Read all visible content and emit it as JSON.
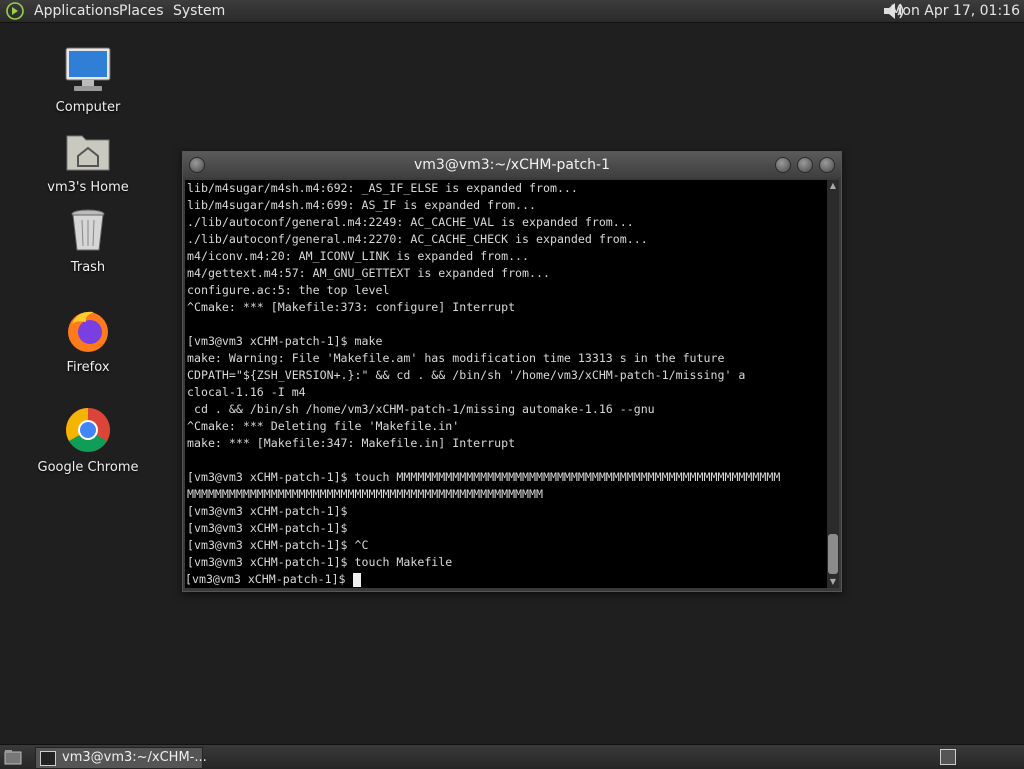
{
  "top_panel": {
    "menus": [
      "Applications",
      "Places",
      "System"
    ],
    "clock": "Mon Apr 17, 01:16"
  },
  "desktop": {
    "icons": [
      {
        "label": "Computer",
        "icon": "computer-icon"
      },
      {
        "label": "vm3's Home",
        "icon": "home-folder-icon"
      },
      {
        "label": "Trash",
        "icon": "trash-icon"
      },
      {
        "label": "Firefox",
        "icon": "firefox-icon"
      },
      {
        "label": "Google Chrome",
        "icon": "chrome-icon"
      }
    ]
  },
  "terminal": {
    "title": "vm3@vm3:~/xCHM-patch-1",
    "lines": [
      "lib/m4sugar/m4sh.m4:692: _AS_IF_ELSE is expanded from...",
      "lib/m4sugar/m4sh.m4:699: AS_IF is expanded from...",
      "./lib/autoconf/general.m4:2249: AC_CACHE_VAL is expanded from...",
      "./lib/autoconf/general.m4:2270: AC_CACHE_CHECK is expanded from...",
      "m4/iconv.m4:20: AM_ICONV_LINK is expanded from...",
      "m4/gettext.m4:57: AM_GNU_GETTEXT is expanded from...",
      "configure.ac:5: the top level",
      "^Cmake: *** [Makefile:373: configure] Interrupt",
      "",
      "[vm3@vm3 xCHM-patch-1]$ make",
      "make: Warning: File 'Makefile.am' has modification time 13313 s in the future",
      "CDPATH=\"${ZSH_VERSION+.}:\" && cd . && /bin/sh '/home/vm3/xCHM-patch-1/missing' a",
      "clocal-1.16 -I m4",
      " cd . && /bin/sh /home/vm3/xCHM-patch-1/missing automake-1.16 --gnu",
      "^Cmake: *** Deleting file 'Makefile.in'",
      "make: *** [Makefile:347: Makefile.in] Interrupt",
      "",
      "[vm3@vm3 xCHM-patch-1]$ touch MMMMMMMMMMMMMMMMMMMMMMMMMMMMMMMMMMMMMMMMMMMMMMMMMMMMMMM",
      "MMMMMMMMMMMMMMMMMMMMMMMMMMMMMMMMMMMMMMMMMMMMMMMMMMM",
      "[vm3@vm3 xCHM-patch-1]$",
      "[vm3@vm3 xCHM-patch-1]$",
      "[vm3@vm3 xCHM-patch-1]$ ^C",
      "[vm3@vm3 xCHM-patch-1]$ touch Makefile"
    ],
    "prompt": "[vm3@vm3 xCHM-patch-1]$ "
  },
  "taskbar": {
    "task_label": "vm3@vm3:~/xCHM-..."
  }
}
